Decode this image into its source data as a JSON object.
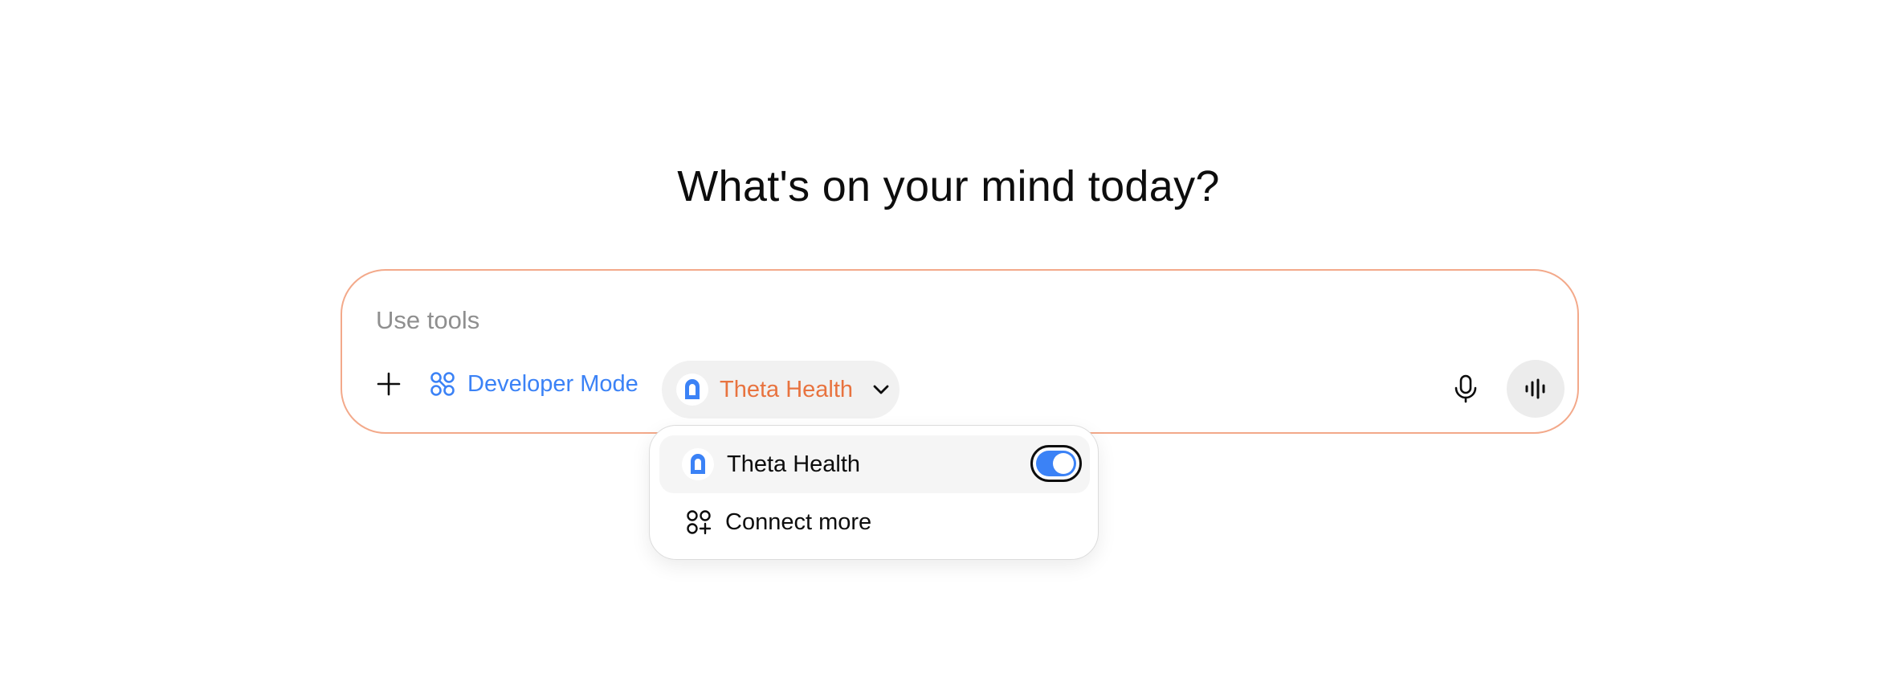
{
  "headline": "What's on your mind today?",
  "composer": {
    "placeholder": "Use tools",
    "value": ""
  },
  "toolbar": {
    "plus_icon": "plus-icon",
    "developer_mode_label": "Developer Mode",
    "developer_mode_icon": "developer-mode-icon",
    "app_pill_label": "Theta Health",
    "app_pill_icon": "theta-health-logo",
    "mic_icon": "microphone-icon",
    "voice_icon": "voice-waveform-icon"
  },
  "dropdown": {
    "items": [
      {
        "label": "Theta Health",
        "icon": "theta-health-logo",
        "toggle_on": true
      },
      {
        "label": "Connect more",
        "icon": "connect-apps-icon"
      }
    ]
  },
  "colors": {
    "accent_blue": "#3b82f6",
    "accent_orange": "#e8733f",
    "composer_border": "#f3a98a"
  }
}
